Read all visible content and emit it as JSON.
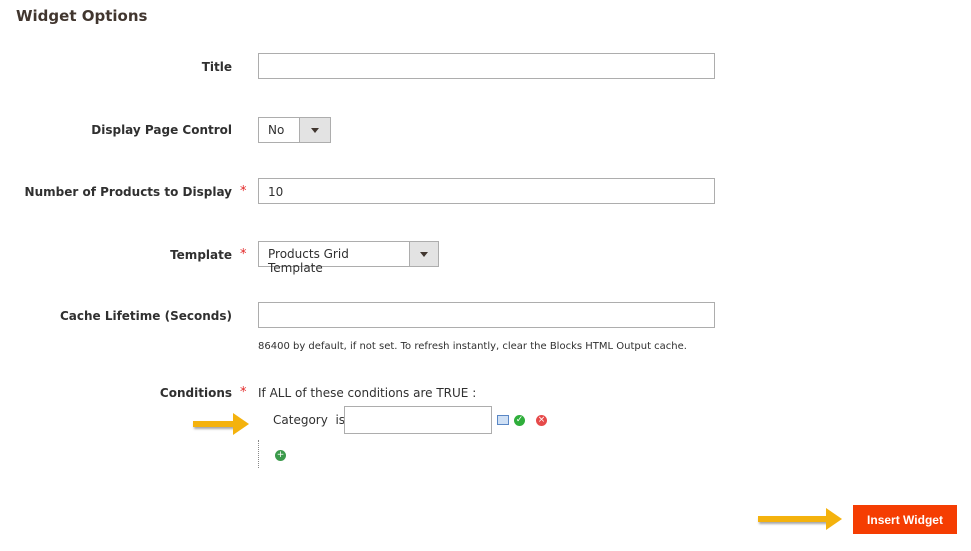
{
  "section_title": "Widget Options",
  "fields": {
    "title": {
      "label": "Title",
      "value": ""
    },
    "page_control": {
      "label": "Display Page Control",
      "value": "No"
    },
    "num_products": {
      "label": "Number of Products to Display",
      "value": "10",
      "required": true
    },
    "template": {
      "label": "Template",
      "value": "Products Grid Template",
      "required": true
    },
    "cache": {
      "label": "Cache Lifetime (Seconds)",
      "value": "",
      "note": "86400 by default, if not set. To refresh instantly, clear the Blocks HTML Output cache."
    },
    "conditions": {
      "label": "Conditions",
      "required": true,
      "pre": "If",
      "aggregator": "ALL",
      "mid": "of these conditions are",
      "value": "TRUE",
      "post": ":",
      "attribute": "Category",
      "operator": "is",
      "input": ""
    }
  },
  "required_mark": "*",
  "insert_button": "Insert Widget",
  "colors": {
    "accent": "#f53d02",
    "arrow": "#f4b20d",
    "required": "#e22626"
  }
}
